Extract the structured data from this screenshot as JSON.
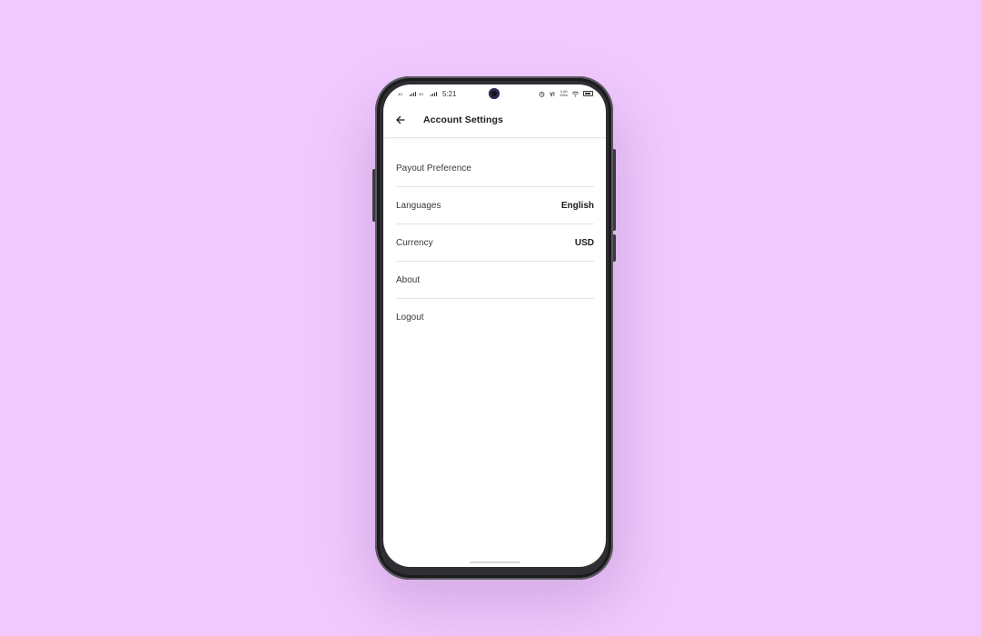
{
  "status_bar": {
    "network_1": "4G",
    "network_2": "4G",
    "time": "5:21",
    "speed": "0.60",
    "speed_unit": "KB/s",
    "icons": [
      "alarm-icon",
      "volte-icon",
      "wifi-icon",
      "battery-icon"
    ]
  },
  "app_bar": {
    "back_icon": "arrow-left-icon",
    "title": "Account Settings"
  },
  "settings": {
    "items": [
      {
        "label": "Payout Preference",
        "value": ""
      },
      {
        "label": "Languages",
        "value": "English"
      },
      {
        "label": "Currency",
        "value": "USD"
      },
      {
        "label": "About",
        "value": ""
      },
      {
        "label": "Logout",
        "value": ""
      }
    ]
  },
  "colors": {
    "background": "#f0c9fd",
    "screen": "#ffffff",
    "divider": "#e3e3e3",
    "text_primary": "#1c1c1c",
    "text_secondary": "#3a3a3a",
    "phone_frame": "#2f2f33"
  }
}
